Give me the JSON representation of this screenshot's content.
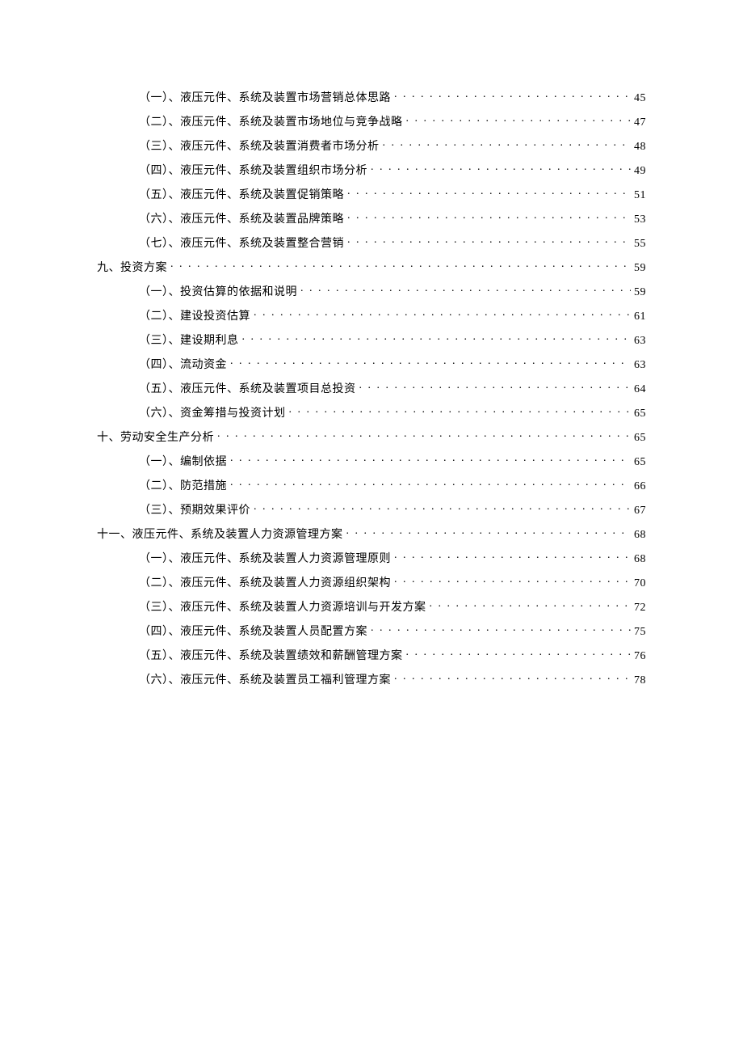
{
  "toc": [
    {
      "level": 2,
      "label": "（一）、液压元件、系统及装置市场营销总体思路",
      "page": "45"
    },
    {
      "level": 2,
      "label": "（二）、液压元件、系统及装置市场地位与竞争战略",
      "page": "47"
    },
    {
      "level": 2,
      "label": "（三）、液压元件、系统及装置消费者市场分析",
      "page": "48"
    },
    {
      "level": 2,
      "label": "（四）、液压元件、系统及装置组织市场分析",
      "page": "49"
    },
    {
      "level": 2,
      "label": "（五）、液压元件、系统及装置促销策略",
      "page": "51"
    },
    {
      "level": 2,
      "label": "（六）、液压元件、系统及装置品牌策略",
      "page": "53"
    },
    {
      "level": 2,
      "label": "（七）、液压元件、系统及装置整合营销",
      "page": "55"
    },
    {
      "level": 1,
      "label": "九、投资方案",
      "page": "59"
    },
    {
      "level": 2,
      "label": "（一）、投资估算的依据和说明",
      "page": "59"
    },
    {
      "level": 2,
      "label": "（二）、建设投资估算",
      "page": "61"
    },
    {
      "level": 2,
      "label": "（三）、建设期利息",
      "page": "63"
    },
    {
      "level": 2,
      "label": "（四）、流动资金",
      "page": "63"
    },
    {
      "level": 2,
      "label": "（五）、液压元件、系统及装置项目总投资",
      "page": "64"
    },
    {
      "level": 2,
      "label": "（六）、资金筹措与投资计划",
      "page": "65"
    },
    {
      "level": 1,
      "label": "十、劳动安全生产分析",
      "page": "65"
    },
    {
      "level": 2,
      "label": "（一）、编制依据",
      "page": "65"
    },
    {
      "level": 2,
      "label": "（二）、防范措施",
      "page": "66"
    },
    {
      "level": 2,
      "label": "（三）、预期效果评价",
      "page": "67"
    },
    {
      "level": 1,
      "label": "十一、液压元件、系统及装置人力资源管理方案",
      "page": "68"
    },
    {
      "level": 2,
      "label": "（一）、液压元件、系统及装置人力资源管理原则",
      "page": "68"
    },
    {
      "level": 2,
      "label": "（二）、液压元件、系统及装置人力资源组织架构",
      "page": "70"
    },
    {
      "level": 2,
      "label": "（三）、液压元件、系统及装置人力资源培训与开发方案",
      "page": "72"
    },
    {
      "level": 2,
      "label": "（四）、液压元件、系统及装置人员配置方案",
      "page": "75"
    },
    {
      "level": 2,
      "label": "（五）、液压元件、系统及装置绩效和薪酬管理方案",
      "page": "76"
    },
    {
      "level": 2,
      "label": "（六）、液压元件、系统及装置员工福利管理方案",
      "page": "78"
    }
  ]
}
